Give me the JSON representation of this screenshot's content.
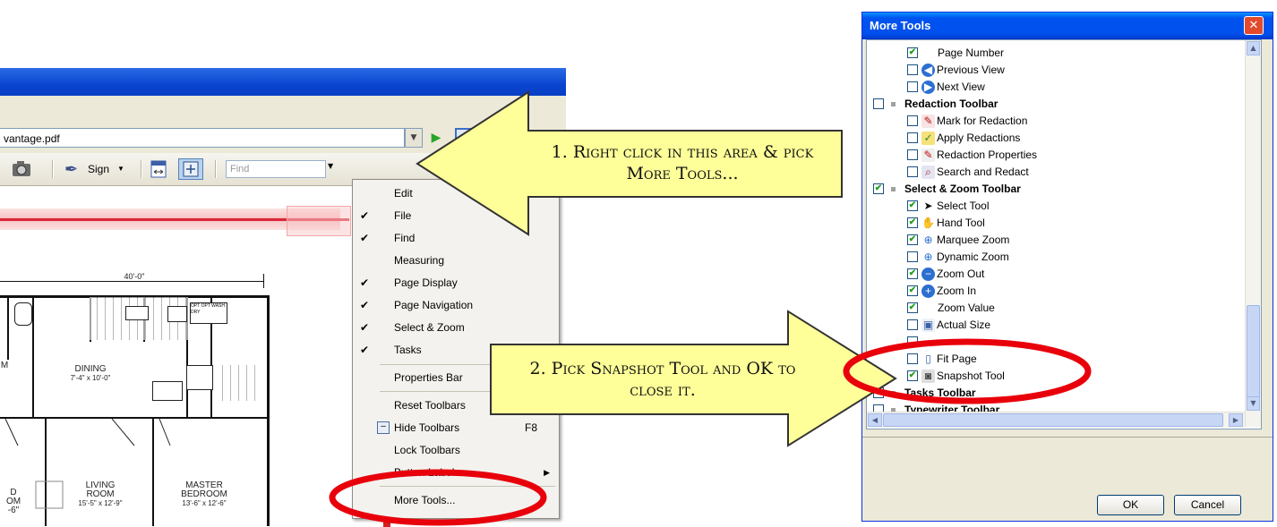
{
  "acrobat": {
    "address_value": "vantage.pdf",
    "sign_label": "Sign",
    "find_placeholder": "Find",
    "floorplan": {
      "dimension": "40'-0\"",
      "rooms": [
        {
          "name": "DINING",
          "size": "7'-4\" x 10'-0\""
        },
        {
          "name": "LIVING\nROOM",
          "size": "15'-5\" x 12'-9\""
        },
        {
          "name": "MASTER\nBEDROOM",
          "size": "13'-6\" x 12'-6\""
        }
      ],
      "partial_labels": [
        "M",
        "D\nOM\n-6\""
      ]
    }
  },
  "context_menu": {
    "items": [
      {
        "label": "Edit",
        "checked": false
      },
      {
        "label": "File",
        "checked": true
      },
      {
        "label": "Find",
        "checked": true
      },
      {
        "label": "Measuring",
        "checked": false
      },
      {
        "label": "Page Display",
        "checked": true
      },
      {
        "label": "Page Navigation",
        "checked": true
      },
      {
        "label": "Select & Zoom",
        "checked": true
      },
      {
        "label": "Tasks",
        "checked": true
      }
    ],
    "properties_bar": "Properties Bar",
    "reset_toolbars": "Reset Toolbars",
    "hide_toolbars": "Hide Toolbars",
    "hide_shortcut": "F8",
    "lock_toolbars": "Lock Toolbars",
    "button_labels": "Button Labels",
    "more_tools": "More Tools..."
  },
  "callouts": {
    "step1": "1. Right click in this area & pick More Tools...",
    "step2": "2. Pick Snapshot Tool and OK to close it."
  },
  "dialog": {
    "title": "More Tools",
    "ok_label": "OK",
    "cancel_label": "Cancel",
    "rows": [
      {
        "label": "Page Number",
        "checked": true,
        "level": 2,
        "icon": "",
        "group": false
      },
      {
        "label": "Previous View",
        "checked": false,
        "level": 2,
        "icon": "previous-view-icon",
        "group": false
      },
      {
        "label": "Next View",
        "checked": false,
        "level": 2,
        "icon": "next-view-icon",
        "group": false
      },
      {
        "label": "Redaction Toolbar",
        "checked": false,
        "level": 1,
        "icon": "",
        "group": true
      },
      {
        "label": "Mark for Redaction",
        "checked": false,
        "level": 2,
        "icon": "mark-redaction-icon",
        "group": false
      },
      {
        "label": "Apply Redactions",
        "checked": false,
        "level": 2,
        "icon": "apply-redactions-icon",
        "group": false
      },
      {
        "label": "Redaction Properties",
        "checked": false,
        "level": 2,
        "icon": "redaction-properties-icon",
        "group": false
      },
      {
        "label": "Search and Redact",
        "checked": false,
        "level": 2,
        "icon": "search-redact-icon",
        "group": false
      },
      {
        "label": "Select & Zoom Toolbar",
        "checked": true,
        "level": 1,
        "icon": "",
        "group": true
      },
      {
        "label": "Select Tool",
        "checked": true,
        "level": 2,
        "icon": "select-tool-icon",
        "group": false
      },
      {
        "label": "Hand Tool",
        "checked": true,
        "level": 2,
        "icon": "hand-tool-icon",
        "group": false
      },
      {
        "label": "Marquee Zoom",
        "checked": true,
        "level": 2,
        "icon": "marquee-zoom-icon",
        "group": false
      },
      {
        "label": "Dynamic Zoom",
        "checked": false,
        "level": 2,
        "icon": "dynamic-zoom-icon",
        "group": false
      },
      {
        "label": "Zoom Out",
        "checked": true,
        "level": 2,
        "icon": "zoom-out-icon",
        "group": false
      },
      {
        "label": "Zoom In",
        "checked": true,
        "level": 2,
        "icon": "zoom-in-icon",
        "group": false
      },
      {
        "label": "Zoom Value",
        "checked": true,
        "level": 2,
        "icon": "",
        "group": false
      },
      {
        "label": "Actual Size",
        "checked": false,
        "level": 2,
        "icon": "actual-size-icon",
        "group": false
      },
      {
        "label": "",
        "checked": false,
        "level": 2,
        "icon": "",
        "group": false
      },
      {
        "label": "Fit Page",
        "checked": false,
        "level": 2,
        "icon": "fit-page-icon",
        "group": false
      },
      {
        "label": "Snapshot Tool",
        "checked": true,
        "level": 2,
        "icon": "snapshot-tool-icon",
        "group": false
      },
      {
        "label": "Tasks Toolbar",
        "checked": true,
        "level": 1,
        "icon": "",
        "group": true
      },
      {
        "label": "Typewriter Toolbar",
        "checked": false,
        "level": 1,
        "icon": "",
        "group": true
      }
    ]
  },
  "colors": {
    "xp_blue": "#0a45d0",
    "callout_fill": "#ffff99",
    "highlight_red": "#e8000b",
    "check_green": "#21a121"
  }
}
